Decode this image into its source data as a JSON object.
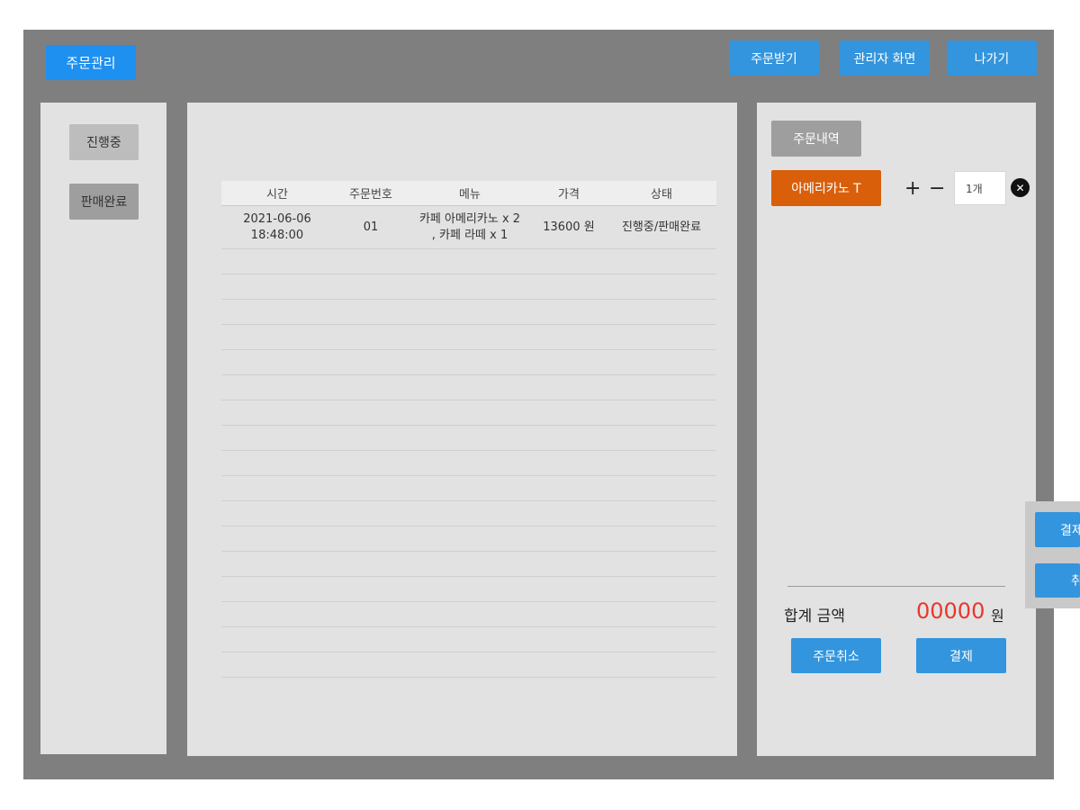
{
  "header": {
    "title": "주문관리",
    "buttons": {
      "receive": "주문받기",
      "admin": "관리자 화면",
      "exit": "나가기"
    }
  },
  "sidebar": {
    "in_progress": "진행중",
    "sold_out": "판매완료"
  },
  "table": {
    "headers": [
      "시간",
      "주문번호",
      "메뉴",
      "가격",
      "상태"
    ],
    "rows": [
      {
        "time": "2021-06-06 18:48:00",
        "order_no": "01",
        "menu": "카페 아메리카노 x 2 , 카페 라떼 x 1",
        "price": "13600 원",
        "status": "진행중/판매완료"
      }
    ]
  },
  "order_panel": {
    "title": "주문내역",
    "item": {
      "name": "아메리카노 T",
      "plus": "+",
      "minus": "−",
      "quantity": "1개",
      "remove": "✕"
    },
    "total_label": "합계 금액",
    "total_value": "00000",
    "currency": "원",
    "cancel_button": "주문취소",
    "pay_button": "결제"
  },
  "overflow_panel": {
    "pay_button": "결제",
    "cancel_button": "취"
  },
  "colors": {
    "frame": "#7f7f7f",
    "panel": "#e2e2e2",
    "accent_blue": "#3395dd",
    "brand_blue": "#1e90f0",
    "item_orange": "#d95f0b",
    "total_red": "#e8372c"
  }
}
